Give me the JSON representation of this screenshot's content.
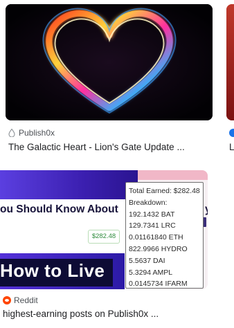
{
  "card1": {
    "source": "Publish0x",
    "title": "The Galactic Heart - Lion's Gate Update ...",
    "next_title_peek": "L"
  },
  "card2": {
    "headline_top": "ou Should Know About",
    "money_badge": "$282.48",
    "headline_bottom": "How to Live",
    "right_peek_letter": "y",
    "tooltip": {
      "total": "Total Earned: $282.48",
      "breakdown_label": "Breakdown:",
      "items": [
        "192.1432 BAT",
        "129.7341 LRC",
        "0.01161840 ETH",
        "822.9966 HYDRO",
        "5.5637 DAI",
        "5.3294 AMPL",
        "0.0145734 IFARM"
      ]
    },
    "source": "Reddit",
    "title": "highest-earning posts on Publish0x ..."
  },
  "icons": {
    "card1_source": "publish0x-drop-icon",
    "card1_peek_source": "verified-icon",
    "card2_source": "reddit-icon"
  },
  "colors": {
    "link_title": "#202124",
    "source_text": "#4d5156",
    "reddit_orange": "#ff4500",
    "badge_green": "#2e8b3c"
  }
}
